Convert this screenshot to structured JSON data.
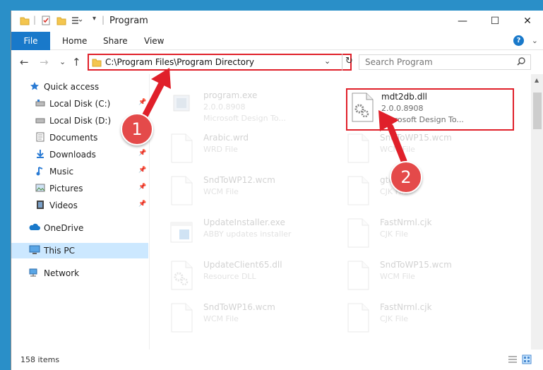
{
  "window": {
    "title": "Program",
    "minimize_glyph": "—",
    "maximize_glyph": "☐",
    "close_glyph": "✕"
  },
  "ribbon": {
    "tabs": [
      "File",
      "Home",
      "Share",
      "View"
    ],
    "collapse_glyph": "⌄",
    "help_glyph": "?"
  },
  "nav": {
    "back_glyph": "←",
    "forward_glyph": "→",
    "recent_glyph": "⌄",
    "up_glyph": "↑",
    "address_path": "C:\\Program Files\\Program Directory",
    "address_dropdown_glyph": "⌄",
    "refresh_glyph": "↻",
    "search_placeholder": "Search Program"
  },
  "sidebar": {
    "items": [
      {
        "label": "Quick access",
        "icon": "star-icon"
      },
      {
        "label": "Local Disk (C:)",
        "icon": "drive-icon"
      },
      {
        "label": "Local Disk (D:)",
        "icon": "drive-icon"
      },
      {
        "label": "Documents",
        "icon": "documents-icon"
      },
      {
        "label": "Downloads",
        "icon": "download-icon"
      },
      {
        "label": "Music",
        "icon": "music-icon"
      },
      {
        "label": "Pictures",
        "icon": "pictures-icon"
      },
      {
        "label": "Videos",
        "icon": "videos-icon"
      },
      {
        "label": "OneDrive",
        "icon": "cloud-icon"
      },
      {
        "label": "This PC",
        "icon": "computer-icon"
      },
      {
        "label": "Network",
        "icon": "network-icon"
      }
    ],
    "pin_glyph": "📌"
  },
  "files": [
    {
      "name": "program.exe",
      "line2": "2.0.0.8908",
      "line3": "Microsoft Design To...",
      "icon": "exe-icon"
    },
    {
      "name": "mdt2db.dll",
      "line2": "2.0.0.8908",
      "line3": "Microsoft Design To...",
      "icon": "dll-gear-icon"
    },
    {
      "name": "Arabic.wrd",
      "line2": "WRD File",
      "icon": "file-icon"
    },
    {
      "name": "SndToWP15.wcm",
      "line2": "WCM File",
      "icon": "file-icon"
    },
    {
      "name": "SndToWP12.wcm",
      "line2": "WCM File",
      "icon": "file-icon"
    },
    {
      "name": "gtd.cjk",
      "line2": "CJK File",
      "icon": "file-icon"
    },
    {
      "name": "UpdateInstaller.exe",
      "line2": "ABBY updates installer",
      "icon": "installer-icon"
    },
    {
      "name": "FastNrml.cjk",
      "line2": "CJK File",
      "icon": "file-icon"
    },
    {
      "name": "UpdateClient65.dll",
      "line2": "Resource DLL",
      "icon": "dll-gear-icon"
    },
    {
      "name": "SndToWP15.wcm",
      "line2": "WCM File",
      "icon": "file-icon"
    },
    {
      "name": "SndToWP16.wcm",
      "line2": "WCM File",
      "icon": "file-icon"
    },
    {
      "name": "FastNrml.cjk",
      "line2": "CJK File",
      "icon": "file-icon"
    }
  ],
  "status": {
    "item_count": "158 items"
  },
  "annotations": {
    "step1": "1",
    "step2": "2",
    "color": "#e0202a"
  }
}
